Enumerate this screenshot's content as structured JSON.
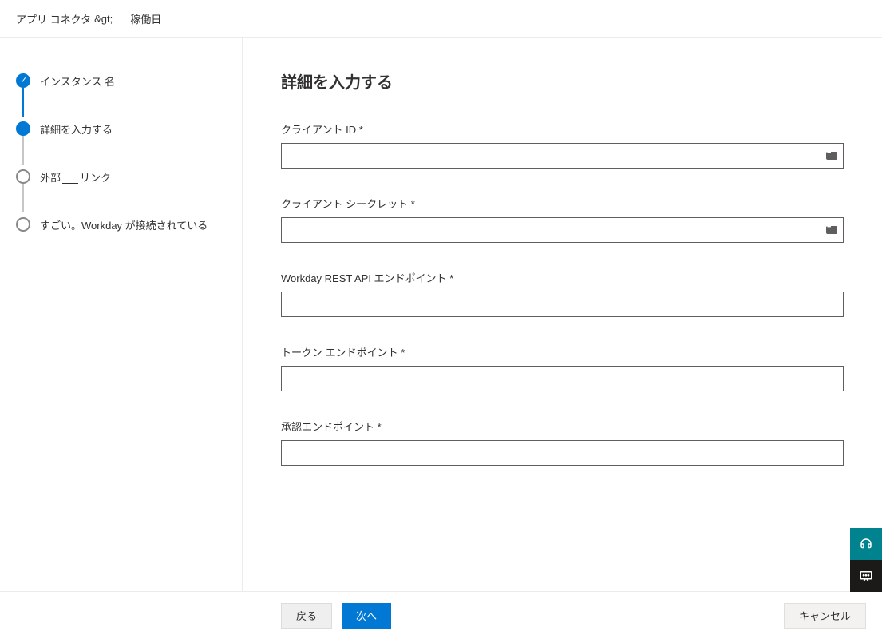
{
  "breadcrumb": {
    "parent": "アプリ コネクタ",
    "sep": "&gt;",
    "current": "稼働日"
  },
  "sidebar": {
    "steps": [
      {
        "label": "インスタンス 名"
      },
      {
        "label": "詳細を入力する"
      },
      {
        "label_pre": "外部",
        "label_post": "リンク"
      },
      {
        "label": "すごい。Workday が接続されている"
      }
    ]
  },
  "main": {
    "title": "詳細を入力する",
    "fields": {
      "client_id": {
        "label": "クライアント ID *",
        "value": ""
      },
      "client_secret": {
        "label": "クライアント シークレット *",
        "value": ""
      },
      "rest_api_endpoint": {
        "label": "Workday REST API エンドポイント *",
        "value": ""
      },
      "token_endpoint": {
        "label": "トークン エンドポイント *",
        "value": ""
      },
      "auth_endpoint": {
        "label": "承認エンドポイント *",
        "value": ""
      }
    }
  },
  "footer": {
    "back": "戻る",
    "next": "次へ",
    "cancel": "キャンセル"
  }
}
